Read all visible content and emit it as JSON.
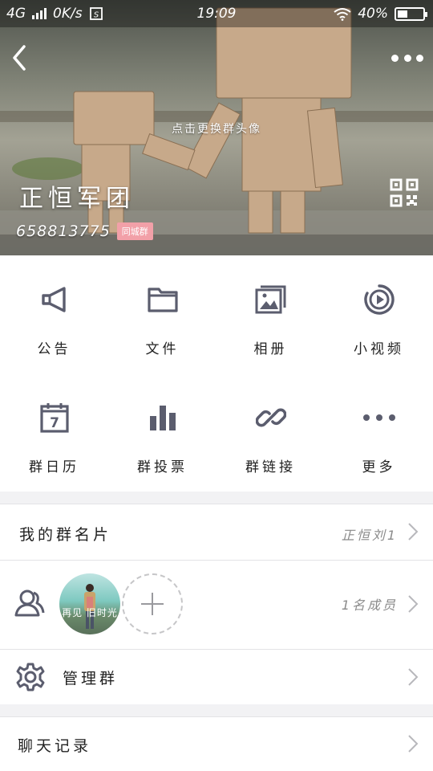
{
  "status_bar": {
    "network": "4G",
    "speed": "0K/s",
    "time": "19:09",
    "battery": "40%",
    "battery_level": 0.4
  },
  "header": {
    "change_avatar_hint": "点击更换群头像",
    "group_name": "正恒军团",
    "group_id": "658813775",
    "badge": "同城群"
  },
  "features": [
    {
      "label": "公告",
      "icon": "megaphone-icon"
    },
    {
      "label": "文件",
      "icon": "folder-icon"
    },
    {
      "label": "相册",
      "icon": "album-icon"
    },
    {
      "label": "小视频",
      "icon": "video-icon"
    },
    {
      "label": "群日历",
      "icon": "calendar-icon"
    },
    {
      "label": "群投票",
      "icon": "vote-chart-icon"
    },
    {
      "label": "群链接",
      "icon": "link-icon"
    },
    {
      "label": "更多",
      "icon": "more-dots-icon"
    }
  ],
  "calendar_day": "7",
  "my_card": {
    "label": "我的群名片",
    "value": "正恒刘1"
  },
  "members": {
    "count_text": "1名成员",
    "avatar_caption": "再见 旧时光"
  },
  "manage": {
    "label": "管理群"
  },
  "chat_history": {
    "label": "聊天记录"
  },
  "colors": {
    "icon": "#5b5d6e",
    "accent": "#f2a0a8",
    "divider": "#e3e3e6"
  }
}
